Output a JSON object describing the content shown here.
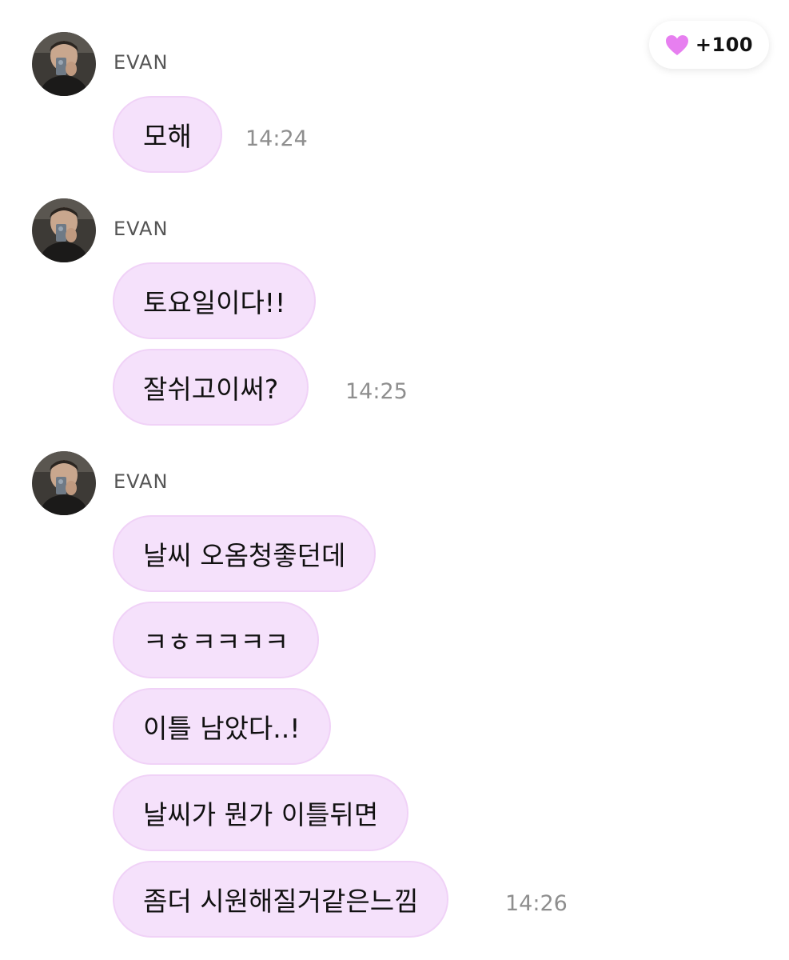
{
  "badge": {
    "icon": "heart-icon",
    "text": "+100",
    "color": "#e77ff0"
  },
  "colors": {
    "bubble": "#f5e1fb",
    "bubble_border": "#f0d2f7",
    "time": "#8e8e8e"
  },
  "groups": [
    {
      "sender": "EVAN",
      "time": "14:24",
      "messages": [
        "모해"
      ]
    },
    {
      "sender": "EVAN",
      "time": "14:25",
      "messages": [
        "토요일이다!!",
        "잘쉬고이써?"
      ]
    },
    {
      "sender": "EVAN",
      "time": "14:26",
      "messages": [
        "날씨 오옴청좋던데",
        "ㅋㅎㅋㅋㅋㅋ",
        "이틀 남았다..!",
        "날씨가 뭔가 이틀뒤면",
        "좀더 시원해질거같은느낌"
      ]
    }
  ]
}
